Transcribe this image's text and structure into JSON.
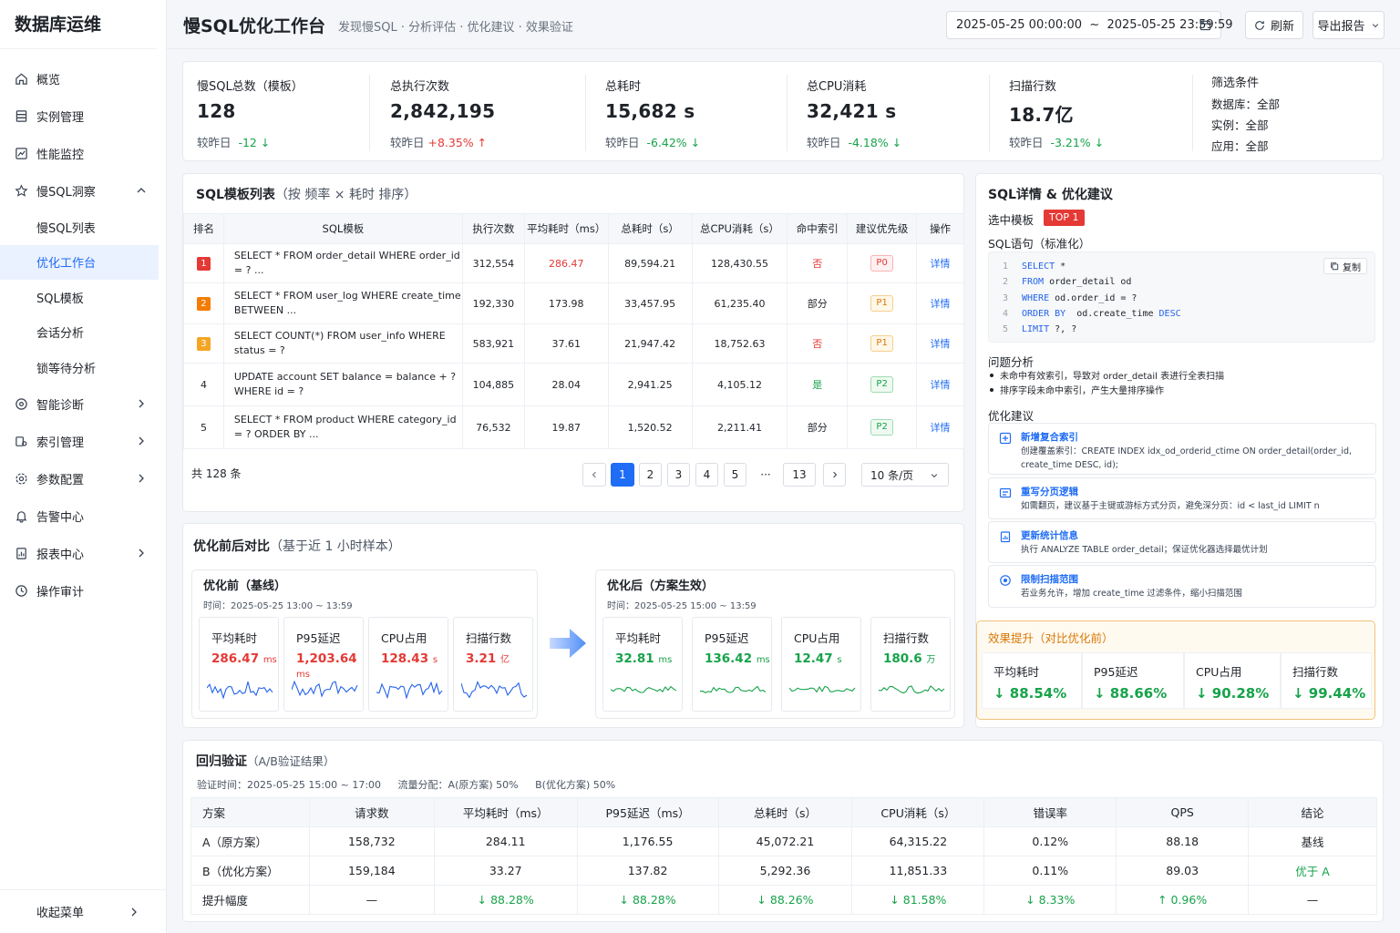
{
  "brand": "数据库运维",
  "nav": [
    {
      "label": "概览",
      "icon": "home-icon"
    },
    {
      "label": "实例管理",
      "icon": "database-icon"
    },
    {
      "label": "性能监控",
      "icon": "chart-icon"
    },
    {
      "label": "慢SQL洞察",
      "icon": "star-icon",
      "expanded": true
    }
  ],
  "nav_sub": [
    "慢SQL列表",
    "优化工作台",
    "SQL模板",
    "会话分析",
    "锁等待分析"
  ],
  "nav_bottom": [
    {
      "label": "智能诊断",
      "icon": "diagnose-icon",
      "chevron": true
    },
    {
      "label": "索引管理",
      "icon": "index-icon",
      "chevron": true
    },
    {
      "label": "参数配置",
      "icon": "gear-icon",
      "chevron": true
    },
    {
      "label": "告警中心",
      "icon": "bell-icon",
      "chevron": false
    },
    {
      "label": "报表中心",
      "icon": "report-icon",
      "chevron": true
    },
    {
      "label": "操作审计",
      "icon": "audit-icon",
      "chevron": false
    }
  ],
  "collapse_label": "收起菜单",
  "header": {
    "title": "慢SQL优化工作台",
    "subtitle": "发现慢SQL · 分析评估 · 优化建议 · 效果验证",
    "date_range": "2025-05-25 00:00:00  ~  2025-05-25 23:59:59",
    "refresh": "刷新",
    "export": "导出报告"
  },
  "stats": [
    {
      "label": "慢SQL总数（模板）",
      "value": "128",
      "cmp_label": "较昨日",
      "cmp": "-12",
      "dir": "down"
    },
    {
      "label": "总执行次数",
      "value": "2,842,195",
      "cmp_label": "较昨日",
      "cmp": "+8.35%",
      "dir": "up"
    },
    {
      "label": "总耗时",
      "value": "15,682 s",
      "cmp_label": "较昨日",
      "cmp": "-6.42%",
      "dir": "down"
    },
    {
      "label": "总CPU消耗",
      "value": "32,421 s",
      "cmp_label": "较昨日",
      "cmp": "-4.18%",
      "dir": "down"
    },
    {
      "label": "扫描行数",
      "value": "18.7亿",
      "cmp_label": "较昨日",
      "cmp": "-3.21%",
      "dir": "down"
    }
  ],
  "filter": {
    "title": "筛选条件",
    "db": "数据库：全部",
    "instance": "实例：全部",
    "app": "应用：全部"
  },
  "sql_list": {
    "title": "SQL模板列表",
    "title_note": "（按 频率 × 耗时 排序）",
    "columns": [
      "排名",
      "SQL模板",
      "执行次数",
      "平均耗时（ms）",
      "总耗时（s）",
      "总CPU消耗（s）",
      "命中索引",
      "建议优先级",
      "操作"
    ],
    "rows": [
      {
        "rank": "1",
        "sql": "SELECT * FROM order_detail WHERE order_id = ? ...",
        "count": "312,554",
        "avg": "286.47",
        "total": "89,594.21",
        "cpu": "128,430.55",
        "idx": "否",
        "prio": "P0",
        "op": "详情"
      },
      {
        "rank": "2",
        "sql": "SELECT * FROM user_log WHERE create_time BETWEEN ...",
        "count": "192,330",
        "avg": "173.98",
        "total": "33,457.95",
        "cpu": "61,235.40",
        "idx": "部分",
        "prio": "P1",
        "op": "详情"
      },
      {
        "rank": "3",
        "sql": "SELECT COUNT(*) FROM user_info WHERE status = ?",
        "count": "583,921",
        "avg": "37.61",
        "total": "21,947.42",
        "cpu": "18,752.63",
        "idx": "否",
        "prio": "P1",
        "op": "详情"
      },
      {
        "rank": "4",
        "sql": "UPDATE account SET balance = balance + ? WHERE id = ?",
        "count": "104,885",
        "avg": "28.04",
        "total": "2,941.25",
        "cpu": "4,105.12",
        "idx": "是",
        "prio": "P2",
        "op": "详情"
      },
      {
        "rank": "5",
        "sql": "SELECT * FROM product WHERE category_id = ? ORDER BY ...",
        "count": "76,532",
        "avg": "19.87",
        "total": "1,520.52",
        "cpu": "2,211.41",
        "idx": "部分",
        "prio": "P2",
        "op": "详情"
      }
    ],
    "total": "共 128 条",
    "pages": [
      "1",
      "2",
      "3",
      "4",
      "5",
      "···",
      "13"
    ],
    "page_size": "10 条/页"
  },
  "compare": {
    "title": "优化前后对比",
    "title_note": "（基于近 1 小时样本）",
    "before": {
      "title": "优化前（基线）",
      "time": "时间：2025-05-25 13:00 ~ 13:59",
      "metrics": [
        {
          "label": "平均耗时",
          "value": "286.47",
          "unit": "ms"
        },
        {
          "label": "P95延迟",
          "value": "1,203.64",
          "unit": "ms"
        },
        {
          "label": "CPU占用",
          "value": "128.43",
          "unit": "s"
        },
        {
          "label": "扫描行数",
          "value": "3.21",
          "unit": "亿"
        }
      ]
    },
    "after": {
      "title": "优化后（方案生效）",
      "time": "时间：2025-05-25 15:00 ~ 13:59",
      "metrics": [
        {
          "label": "平均耗时",
          "value": "32.81",
          "unit": "ms"
        },
        {
          "label": "P95延迟",
          "value": "136.42",
          "unit": "ms"
        },
        {
          "label": "CPU占用",
          "value": "12.47",
          "unit": "s"
        },
        {
          "label": "扫描行数",
          "value": "180.6",
          "unit": "万"
        }
      ]
    }
  },
  "detail": {
    "title": "SQL详情 & 优化建议",
    "selected_label": "选中模板",
    "selected_badge": "TOP 1",
    "sql_label": "SQL语句（标准化）",
    "copy": "复制",
    "code": [
      {
        "n": "1",
        "kw": "SELECT",
        "rest": " *"
      },
      {
        "n": "2",
        "kw": "FROM",
        "rest": " order_detail od"
      },
      {
        "n": "3",
        "kw": "WHERE",
        "rest": " od.order_id = ?"
      },
      {
        "n": "4",
        "kw": "ORDER BY",
        "rest": "  od.create_time ",
        "kw2": "DESC"
      },
      {
        "n": "5",
        "kw": "LIMIT",
        "rest": " ?, ?"
      }
    ],
    "problem_title": "问题分析",
    "problems": [
      "未命中有效索引，导致对 order_detail 表进行全表扫描",
      "排序字段未命中索引，产生大量排序操作"
    ],
    "suggest_title": "优化建议",
    "suggestions": [
      {
        "title": "新增复合索引",
        "desc": "创建覆盖索引：CREATE INDEX idx_od_orderid_ctime ON order_detail(order_id, create_time DESC, id);",
        "icon": "index-add-icon"
      },
      {
        "title": "重写分页逻辑",
        "desc": "如需翻页，建议基于主键或游标方式分页，避免深分页：id < last_id LIMIT n",
        "icon": "page-icon"
      },
      {
        "title": "更新统计信息",
        "desc": "执行 ANALYZE TABLE order_detail；保证优化器选择最优计划",
        "icon": "stats-icon"
      },
      {
        "title": "限制扫描范围",
        "desc": "若业务允许，增加 create_time 过滤条件，缩小扫描范围",
        "icon": "target-icon"
      }
    ],
    "effect_title": "效果提升（对比优化前）",
    "effects": [
      {
        "label": "平均耗时",
        "value": "↓ 88.54%"
      },
      {
        "label": "P95延迟",
        "value": "↓ 88.66%"
      },
      {
        "label": "CPU占用",
        "value": "↓ 90.28%"
      },
      {
        "label": "扫描行数",
        "value": "↓ 99.44%"
      }
    ]
  },
  "regression": {
    "title": "回归验证",
    "title_note": "（A/B验证结果）",
    "time": "验证时间：2025-05-25 15:00 ~ 17:00",
    "traffic": "流量分配：A(原方案) 50%",
    "traffic_b": "B(优化方案) 50%",
    "columns": [
      "方案",
      "请求数",
      "平均耗时（ms）",
      "P95延迟（ms）",
      "总耗时（s）",
      "CPU消耗（s）",
      "错误率",
      "QPS",
      "结论"
    ],
    "rows": [
      [
        "A（原方案）",
        "158,732",
        "284.11",
        "1,176.55",
        "45,072.21",
        "64,315.22",
        "0.12%",
        "88.18",
        "基线"
      ],
      [
        "B（优化方案）",
        "159,184",
        "33.27",
        "137.82",
        "5,292.36",
        "11,851.33",
        "0.11%",
        "89.03",
        "优于 A"
      ],
      [
        "提升幅度",
        "—",
        "↓ 88.28%",
        "↓ 88.28%",
        "↓ 88.26%",
        "↓ 81.58%",
        "↓ 8.33%",
        "↑ 0.96%",
        "—"
      ]
    ]
  },
  "colors": {
    "accent": "#1f6cf5",
    "good": "#16a34a",
    "bad": "#e53935",
    "warn": "#f5a524"
  }
}
